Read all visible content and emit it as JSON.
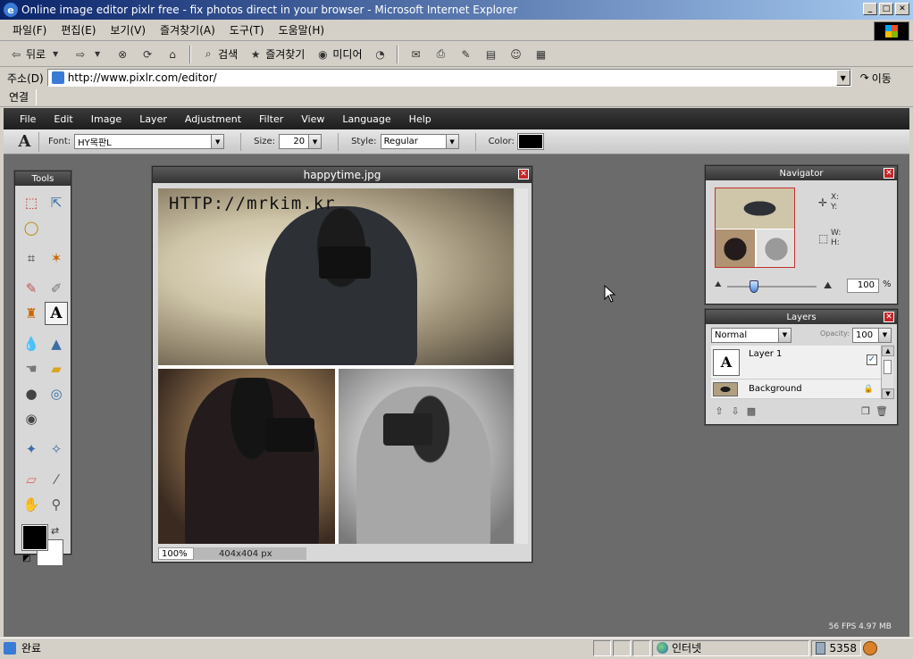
{
  "window": {
    "title": "Online image editor pixlr free - fix photos direct in your browser - Microsoft Internet Explorer",
    "min": "_",
    "max": "□",
    "close": "✕"
  },
  "ie_menu": [
    "파일(F)",
    "편집(E)",
    "보기(V)",
    "즐겨찾기(A)",
    "도구(T)",
    "도움말(H)"
  ],
  "ie_toolbar": {
    "back": "뒤로",
    "search": "검색",
    "favorites": "즐겨찾기",
    "media": "미디어"
  },
  "address": {
    "label": "주소(D)",
    "url": "http://www.pixlr.com/editor/",
    "go": "이동"
  },
  "links_label": "연결",
  "app_menu": [
    "File",
    "Edit",
    "Image",
    "Layer",
    "Adjustment",
    "Filter",
    "View",
    "Language",
    "Help"
  ],
  "options": {
    "tool_glyph": "A",
    "font_label": "Font:",
    "font_value": "HY목판L",
    "size_label": "Size:",
    "size_value": "20",
    "style_label": "Style:",
    "style_value": "Regular",
    "color_label": "Color:",
    "color_value": "#000000"
  },
  "tools_panel": {
    "title": "Tools",
    "type_tool_glyph": "A"
  },
  "document": {
    "title": "happytime.jpg",
    "watermark": "HTTP://mrkim.kr",
    "zoom": "100%",
    "size": "404x404 px"
  },
  "navigator": {
    "title": "Navigator",
    "x_label": "X:",
    "y_label": "Y:",
    "w_label": "W:",
    "h_label": "H:",
    "zoom_value": "100",
    "zoom_unit": "%",
    "zoom_slider_level": 0.3
  },
  "layers": {
    "title": "Layers",
    "blend_mode": "Normal",
    "opacity_label": "Opacity:",
    "opacity_value": "100",
    "items": [
      {
        "name": "Layer 1",
        "thumb": "A",
        "visible": "✓"
      },
      {
        "name": "Background"
      }
    ]
  },
  "fps": "56 FPS 4.97 MB",
  "ie_status": {
    "text": "완료",
    "zone": "인터넷",
    "count": "5358"
  }
}
